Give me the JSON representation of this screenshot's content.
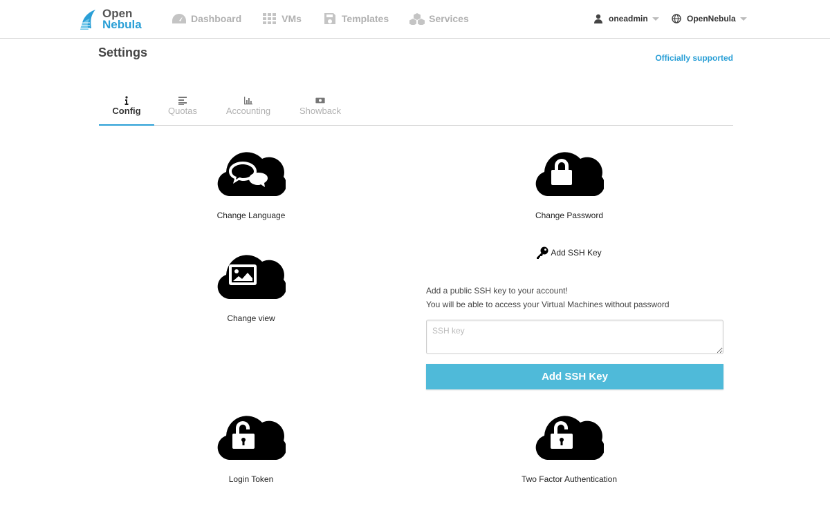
{
  "brand": {
    "line1": "Open",
    "line2": "Nebula",
    "color": "#2a9fd6"
  },
  "nav": {
    "items": [
      {
        "label": "Dashboard",
        "icon": "dashboard-icon"
      },
      {
        "label": "VMs",
        "icon": "grid-icon"
      },
      {
        "label": "Templates",
        "icon": "save-icon"
      },
      {
        "label": "Services",
        "icon": "cubes-icon"
      }
    ]
  },
  "user_menu": {
    "user": "oneadmin",
    "zone": "OpenNebula"
  },
  "page": {
    "title": "Settings",
    "support": "Officially supported"
  },
  "tabs": [
    {
      "label": "Config",
      "icon": "info-icon",
      "active": true
    },
    {
      "label": "Quotas",
      "icon": "align-left-icon",
      "active": false
    },
    {
      "label": "Accounting",
      "icon": "bar-chart-icon",
      "active": false
    },
    {
      "label": "Showback",
      "icon": "money-icon",
      "active": false
    }
  ],
  "tiles": {
    "change_language": "Change Language",
    "change_password": "Change Password",
    "change_view": "Change view",
    "login_token": "Login Token",
    "two_factor": "Two Factor Authentication"
  },
  "ssh": {
    "header": "Add SSH Key",
    "desc_line1": "Add a public SSH key to your account!",
    "desc_line2": "You will be able to access your Virtual Machines without password",
    "placeholder": "SSH key",
    "button": "Add SSH Key"
  },
  "colors": {
    "accent": "#2a9fd6",
    "button": "#4fbad9"
  }
}
